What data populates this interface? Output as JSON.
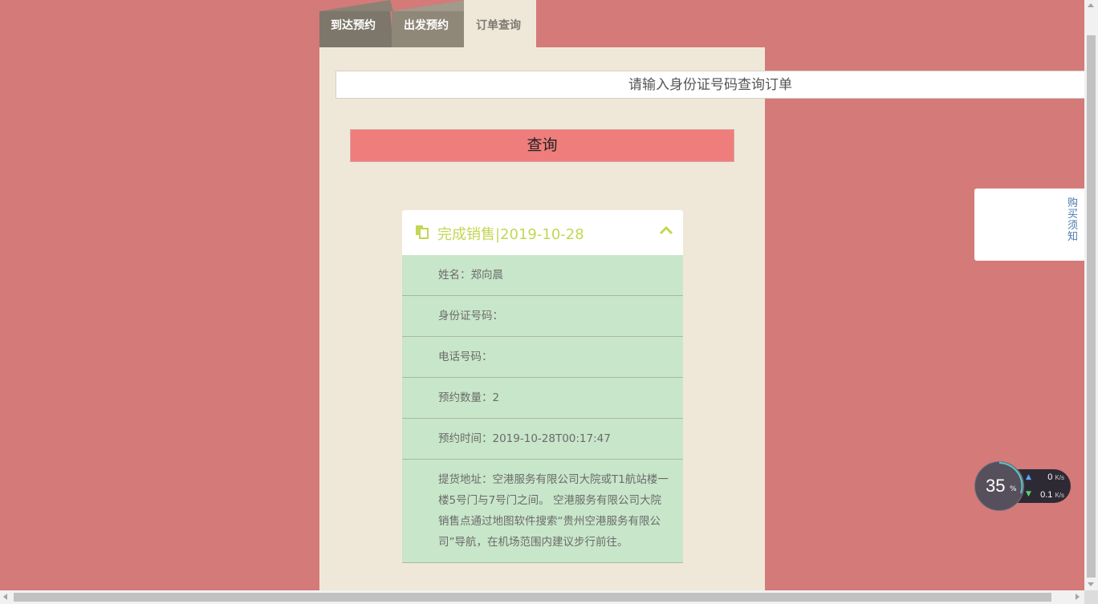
{
  "tabs": [
    {
      "label": "到达预约"
    },
    {
      "label": "出发预约"
    },
    {
      "label": "订单查询"
    }
  ],
  "search": {
    "placeholder": "请输入身份证号码查询订单",
    "value": ""
  },
  "query_button": {
    "label": "查询"
  },
  "order": {
    "title": "完成销售|2019-10-28",
    "rows": [
      {
        "text": "姓名：郑向晨"
      },
      {
        "text": "身份证号码："
      },
      {
        "text": "电话号码："
      },
      {
        "text": "预约数量：2"
      },
      {
        "text": "预约时间：2019-10-28T00:17:47"
      },
      {
        "text": "提货地址：空港服务有限公司大院或T1航站楼一楼5号门与7号门之间。 空港服务有限公司大院销售点通过地图软件搜索“贵州空港服务有限公司”导航，在机场范围内建议步行前往。"
      }
    ]
  },
  "notice": {
    "label": "购买须知"
  },
  "net_meter": {
    "percent": "35",
    "percent_sign": "%",
    "upload": "0",
    "download": "0.1",
    "unit": "K/s"
  },
  "colors": {
    "page_bg": "#d47a79",
    "panel_bg": "#efe8d8",
    "button_bg": "#ef7d7c",
    "row_bg": "#c8e6c9",
    "title_color": "#c4d653"
  }
}
